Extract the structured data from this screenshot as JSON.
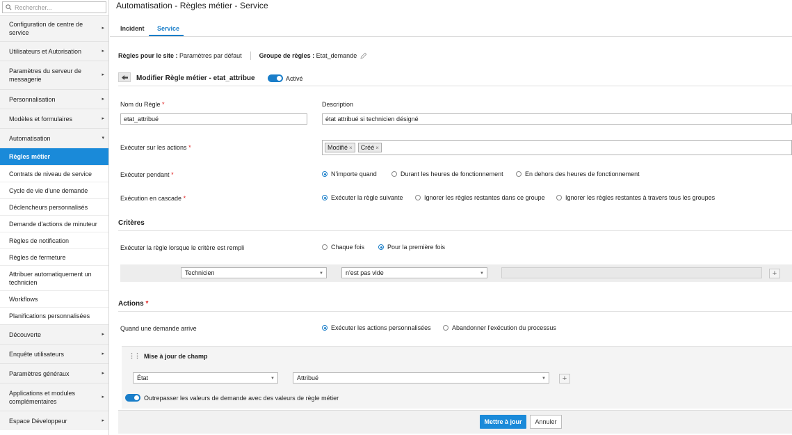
{
  "sidebar": {
    "search_placeholder": "Rechercher...",
    "items": [
      {
        "label": "Configuration de centre de service"
      },
      {
        "label": "Utilisateurs et Autorisation"
      },
      {
        "label": "Paramètres du serveur de messagerie"
      },
      {
        "label": "Personnalisation"
      },
      {
        "label": "Modèles et formulaires"
      },
      {
        "label": "Automatisation"
      }
    ],
    "sub_items": [
      {
        "label": "Règles métier"
      },
      {
        "label": "Contrats de niveau de service"
      },
      {
        "label": "Cycle de vie d'une demande"
      },
      {
        "label": "Déclencheurs personnalisés"
      },
      {
        "label": "Demande d'actions de minuteur"
      },
      {
        "label": "Règles de notification"
      },
      {
        "label": "Règles de fermeture"
      },
      {
        "label": "Attribuer automatiquement un technicien"
      },
      {
        "label": "Workflows"
      },
      {
        "label": "Planifications personnalisées"
      }
    ],
    "bottom_items": [
      {
        "label": "Découverte"
      },
      {
        "label": "Enquête utilisateurs"
      },
      {
        "label": "Paramètres généraux"
      },
      {
        "label": "Applications et modules complémentaires"
      },
      {
        "label": "Espace Développeur"
      }
    ]
  },
  "header": {
    "title": "Automatisation - Règles métier - Service"
  },
  "tabs": [
    {
      "label": "Incident"
    },
    {
      "label": "Service"
    }
  ],
  "site_line": {
    "site_label": "Règles pour le site :",
    "site_value": "Paramètres par défaut",
    "group_label": "Groupe de règles :",
    "group_value": "Etat_demande"
  },
  "section": {
    "title": "Modifier Règle métier - etat_attribue",
    "active_label": "Activé"
  },
  "form": {
    "name_label": "Nom du Règle",
    "name_value": "etat_attribué",
    "desc_label": "Description",
    "desc_value": "état attribué si technicien désigné",
    "exec_actions_label": "Exécuter sur les actions",
    "tags": [
      "Modifié",
      "Créé"
    ],
    "exec_during_label": "Exécuter pendant",
    "exec_during_options": [
      "N'importe quand",
      "Durant les heures de fonctionnement",
      "En dehors des heures de fonctionnement"
    ],
    "cascade_label": "Exécution en cascade",
    "cascade_options": [
      "Exécuter la règle suivante",
      "Ignorer les règles restantes dans ce groupe",
      "Ignorer les règles restantes à travers tous les groupes"
    ],
    "required_mark": "*"
  },
  "criteria": {
    "title": "Critères",
    "rule_label": "Exécuter la règle lorsque le critère est rempli",
    "options": [
      "Chaque fois",
      "Pour la première fois"
    ],
    "field": "Technicien",
    "operator": "n'est pas vide",
    "plus": "+"
  },
  "actions": {
    "title": "Actions",
    "when_label": "Quand une demande arrive",
    "when_options": [
      "Exécuter les actions personnalisées",
      "Abandonner l'exécution du processus"
    ],
    "panel_title": "Mise à jour de champ",
    "field": "État",
    "value": "Attribué",
    "plus": "+",
    "override_label": "Outrepasser les valeurs de demande avec des valeurs de règle métier"
  },
  "footer": {
    "update": "Mettre à jour",
    "cancel": "Annuler"
  }
}
